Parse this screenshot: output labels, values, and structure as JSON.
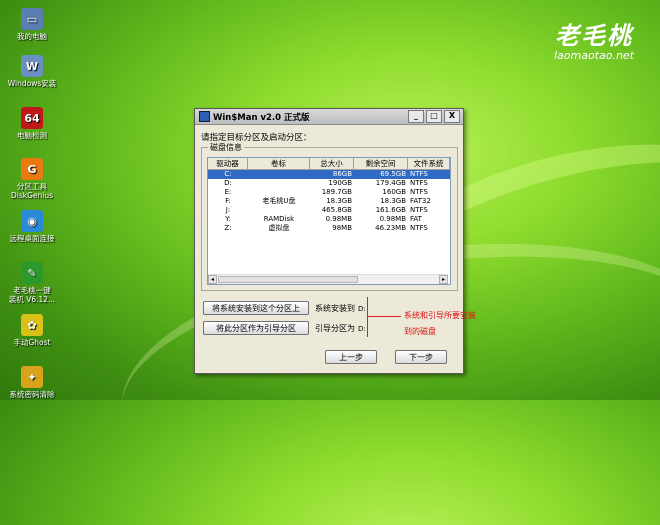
{
  "brand": {
    "cn": "老毛桃",
    "en": "laomaotao.net"
  },
  "desktop": [
    {
      "label": "我的电脑",
      "icon": "computer-icon",
      "color": "#5b7fb3",
      "glyph": "▭"
    },
    {
      "label": "Windows安装",
      "icon": "windows-setup-icon",
      "color": "#6a8fc0",
      "glyph": "W"
    },
    {
      "label": "电脑检测",
      "icon": "system-check-icon",
      "color": "#c01818",
      "glyph": "64"
    },
    {
      "label": "分区工具\nDiskGenius",
      "icon": "diskgenius-icon",
      "color": "#e87a10",
      "glyph": "G"
    },
    {
      "label": "远程桌面连接",
      "icon": "remote-desktop-icon",
      "color": "#2a8ad8",
      "glyph": "◉"
    },
    {
      "label": "老毛桃一键\n装机 V6.12...",
      "icon": "one-click-install-icon",
      "color": "#2b9a2b",
      "glyph": "✎"
    },
    {
      "label": "手动Ghost",
      "icon": "ghost-icon",
      "color": "#d8c21a",
      "glyph": "✿"
    },
    {
      "label": "系统密码清除",
      "icon": "key-icon",
      "color": "#d8a21a",
      "glyph": "✦"
    }
  ],
  "dialog": {
    "title": "Win$Man v2.0 正式版",
    "min": "_",
    "max": "□",
    "close": "X",
    "prompt": "请指定目标分区及启动分区：",
    "group_label": "磁盘信息",
    "columns": [
      "驱动器",
      "卷标",
      "总大小",
      "剩余空间",
      "文件系统"
    ],
    "rows": [
      {
        "drive": "C:",
        "label": "",
        "total": "86GB",
        "free": "69.5GB",
        "fs": "NTFS",
        "selected": true
      },
      {
        "drive": "D:",
        "label": "",
        "total": "190GB",
        "free": "179.4GB",
        "fs": "NTFS",
        "selected": false
      },
      {
        "drive": "E:",
        "label": "",
        "total": "189.7GB",
        "free": "160GB",
        "fs": "NTFS",
        "selected": false
      },
      {
        "drive": "F:",
        "label": "老毛桃U盘",
        "total": "18.3GB",
        "free": "18.3GB",
        "fs": "FAT32",
        "selected": false
      },
      {
        "drive": "J:",
        "label": "",
        "total": "465.8GB",
        "free": "161.6GB",
        "fs": "NTFS",
        "selected": false
      },
      {
        "drive": "Y:",
        "label": "RAMDisk",
        "total": "0.98MB",
        "free": "0.98MB",
        "fs": "FAT",
        "selected": false
      },
      {
        "drive": "Z:",
        "label": "虚拟盘",
        "total": "98MB",
        "free": "46.23MB",
        "fs": "NTFS",
        "selected": false
      }
    ],
    "scroll_left": "◂",
    "scroll_right": "▸",
    "install_btn": "将系统安装到这个分区上",
    "boot_btn": "将此分区作为引导分区",
    "install_lbl": "系统安装到",
    "boot_lbl": "引导分区为",
    "install_drive": "D:",
    "boot_drive": "D:",
    "prev_btn": "上一步",
    "next_btn": "下一步"
  },
  "annotation": {
    "line1": "系统和引导所要安装",
    "line2": "到的磁盘"
  }
}
